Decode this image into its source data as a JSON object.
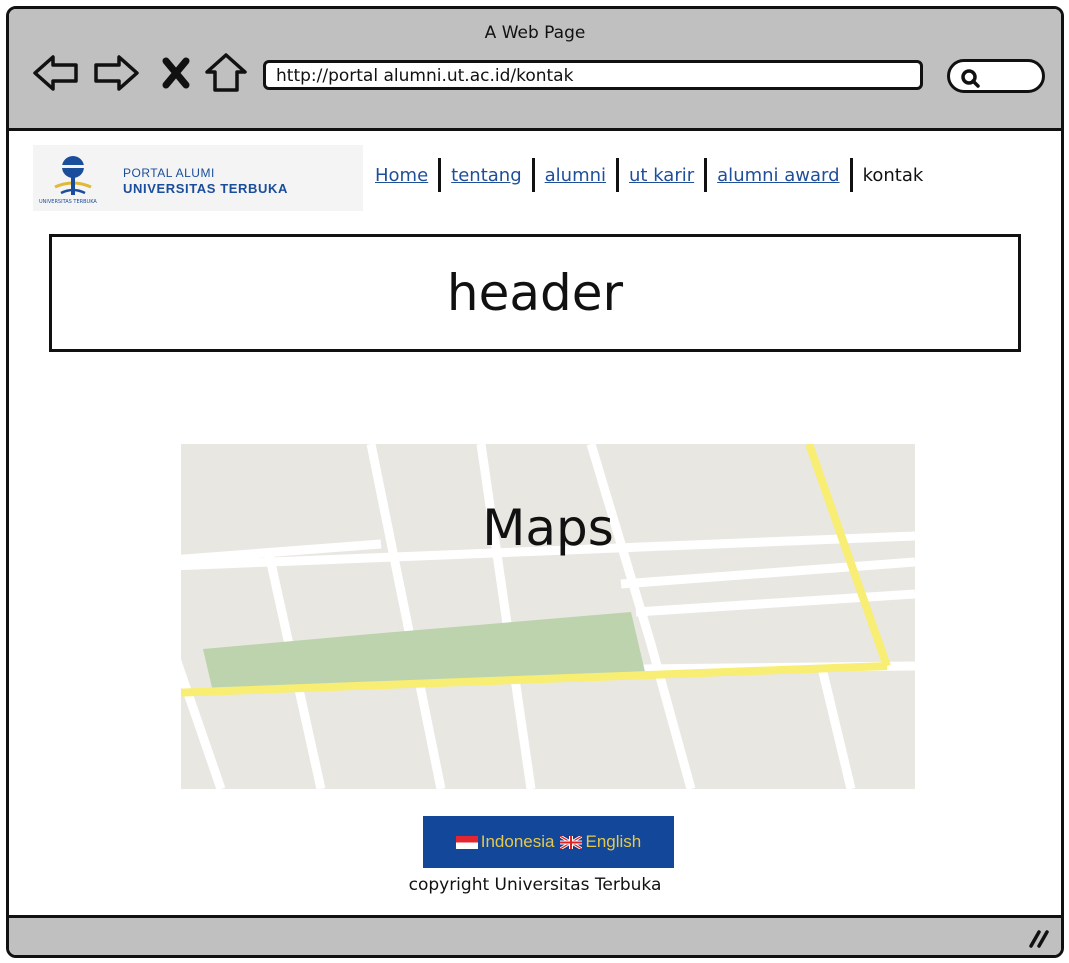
{
  "window": {
    "title": "A Web Page"
  },
  "browser": {
    "url": "http://portal alumni.ut.ac.id/kontak",
    "buttons": [
      "back-icon",
      "forward-icon",
      "close-icon",
      "home-icon"
    ],
    "search_icon": "search-icon"
  },
  "logo": {
    "line1": "PORTAL ALUMI",
    "line2": "UNIVERSITAS TERBUKA",
    "tiny": "UNIVERSITAS TERBUKA",
    "color": "#1a4d9b"
  },
  "nav": {
    "items": [
      {
        "label": "Home",
        "link": true
      },
      {
        "label": "tentang",
        "link": true
      },
      {
        "label": "alumni",
        "link": true
      },
      {
        "label": "ut karir",
        "link": true
      },
      {
        "label": "alumni award",
        "link": true
      },
      {
        "label": "kontak",
        "link": false
      }
    ],
    "link_color": "#1f4f9a"
  },
  "header": {
    "label": "header"
  },
  "map": {
    "label": "Maps",
    "colors": {
      "ground": "#e9e7e1",
      "road": "#ffffff",
      "highway": "#f7ee73",
      "park": "#bcd3ad"
    }
  },
  "language": {
    "items": [
      {
        "label": "Indonesia",
        "flag": "indonesia-flag"
      },
      {
        "label": "English",
        "flag": "uk-flag"
      }
    ],
    "bg_color": "#12479a",
    "text_color": "#e6c84a"
  },
  "footer": {
    "copyright": "copyright Universitas Terbuka"
  }
}
